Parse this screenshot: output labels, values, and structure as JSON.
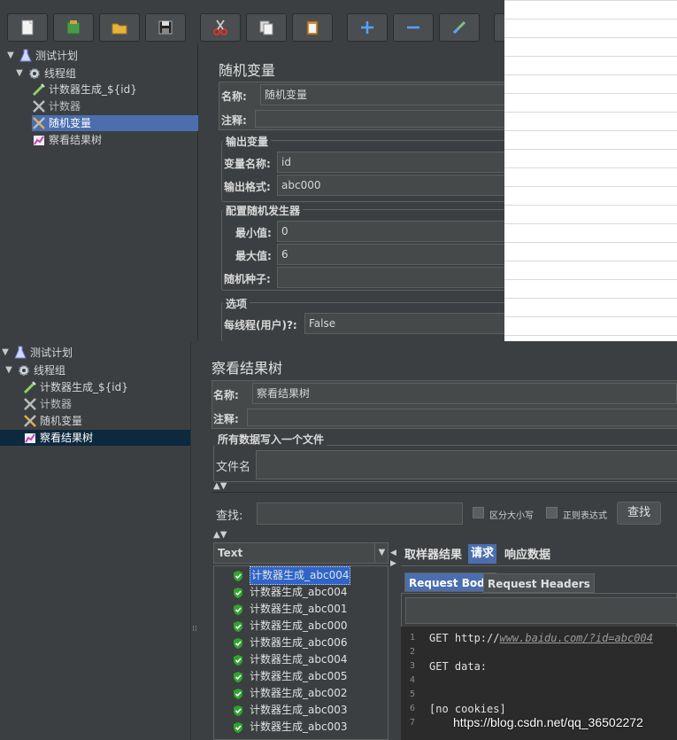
{
  "toolbar": {
    "buttons": [
      "new-icon",
      "templates-icon",
      "open-icon",
      "save-icon",
      "cut-icon",
      "copy-icon",
      "paste-icon",
      "expand-icon",
      "collapse-icon",
      "toggle-icon"
    ]
  },
  "top": {
    "tree": [
      {
        "label": "测试计划",
        "icon": "flask-icon"
      },
      {
        "label": "线程组",
        "icon": "gear-icon"
      },
      {
        "label": "计数器生成_${id}",
        "icon": "sampler-icon"
      },
      {
        "label": "计数器",
        "icon": "tools-icon"
      },
      {
        "label": "随机变量",
        "icon": "tools-icon"
      },
      {
        "label": "察看结果树",
        "icon": "chart-icon"
      }
    ],
    "panel": {
      "title": "随机变量",
      "name_label": "名称:",
      "name_value": "随机变量",
      "comment_label": "注释:",
      "output_group": "输出变量",
      "var_name_label": "变量名称:",
      "var_name_value": "id",
      "format_label": "输出格式:",
      "format_value": "abc000",
      "gen_group": "配置随机发生器",
      "min_label": "最小值:",
      "min_value": "0",
      "max_label": "最大值:",
      "max_value": "6",
      "seed_label": "随机种子:",
      "seed_value": "",
      "options_group": "选项",
      "per_thread_label": "每线程(用户)?:",
      "per_thread_value": "False"
    }
  },
  "bottom": {
    "tree": [
      {
        "label": "测试计划",
        "icon": "flask-icon"
      },
      {
        "label": "线程组",
        "icon": "gear-icon"
      },
      {
        "label": "计数器生成_${id}",
        "icon": "sampler-icon"
      },
      {
        "label": "计数器",
        "icon": "tools-icon"
      },
      {
        "label": "随机变量",
        "icon": "tools-icon"
      },
      {
        "label": "察看结果树",
        "icon": "chart-icon"
      }
    ],
    "panel": {
      "title": "察看结果树",
      "name_label": "名称:",
      "name_value": "察看结果树",
      "comment_label": "注释:",
      "file_group": "所有数据写入一个文件",
      "file_label": "文件名",
      "search_label": "查找:",
      "case_label": "区分大小写",
      "regex_label": "正则表达式",
      "search_button": "查找",
      "renderer": "Text",
      "results": [
        "计数器生成_abc004",
        "计数器生成_abc004",
        "计数器生成_abc001",
        "计数器生成_abc000",
        "计数器生成_abc006",
        "计数器生成_abc004",
        "计数器生成_abc005",
        "计数器生成_abc002",
        "计数器生成_abc003",
        "计数器生成_abc003"
      ],
      "tabs": [
        "取样器结果",
        "请求",
        "响应数据"
      ],
      "active_tab": "请求",
      "sub_tabs": [
        "Request Body",
        "Request Headers"
      ],
      "code_lines": [
        {
          "n": "1",
          "prefix": "GET http://",
          "link": "www.baidu.com/?id=abc004"
        },
        {
          "n": "2",
          "prefix": "",
          "link": ""
        },
        {
          "n": "3",
          "prefix": "GET data:",
          "link": ""
        },
        {
          "n": "4",
          "prefix": "",
          "link": ""
        },
        {
          "n": "5",
          "prefix": "",
          "link": ""
        },
        {
          "n": "6",
          "prefix": "[no cookies]",
          "link": ""
        },
        {
          "n": "7",
          "prefix": "",
          "link": ""
        }
      ]
    }
  },
  "watermark": "https://blog.csdn.net/qq_36502272",
  "colors": {
    "bg": "#3c3f41",
    "selection": "#4b6eaf",
    "success": "#3aa83a"
  }
}
